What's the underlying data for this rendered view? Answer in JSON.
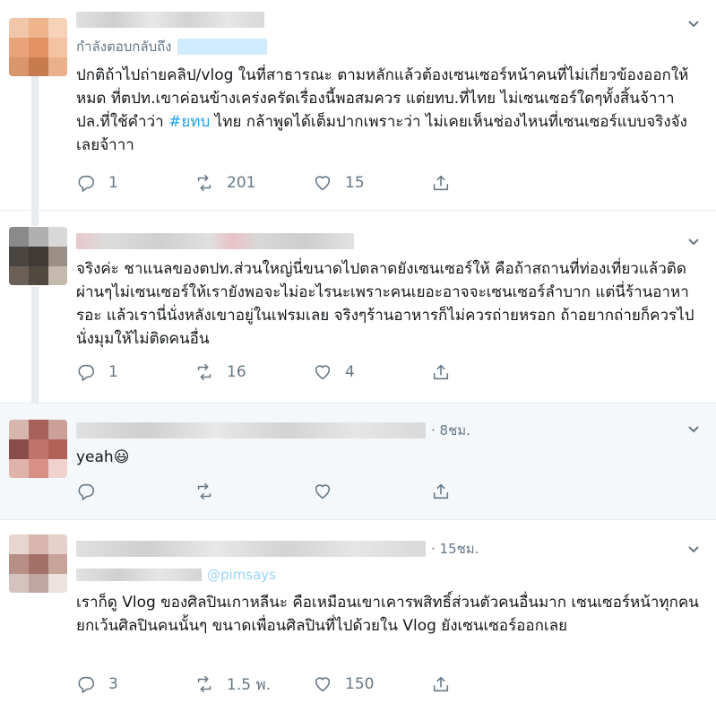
{
  "tweets": [
    {
      "timestamp": "",
      "reply_prefix": "กำลังตอบกลับถึง",
      "reply_handle": "",
      "text_before": "ปกติถ้าไปถ่ายคลิป/vlog ในที่สาธารณะ ตามหลักแล้วต้องเซนเซอร์หน้าคนที่ไม่เกี่ยวข้องออกให้หมด ที่ตปท.เขาค่อนข้างเคร่งครัดเรื่องนี้พอสมควร แต่ยทบ.ที่ไทย ไม่เซนเซอร์ใดๆทั้งสิ้นจ้าาา ปล.ที่ใช้คำว่า ",
      "hashtag": "#ยทบ",
      "text_after": " ไทย กล้าพูดได้เต็มปากเพราะว่า ไม่เคยเห็นช่องไหนที่เซนเซอร์แบบจริงจังเลยจ้าาา",
      "replies": "1",
      "retweets": "201",
      "likes": "15"
    },
    {
      "timestamp": "",
      "text": "จริงค่ะ ชาแนลของตปท.ส่วนใหญ่นี่ขนาดไปตลาดยังเซนเซอร์ให้ คือถ้าสถานที่ท่องเที่ยวแล้วติดผ่านๆไม่เซนเซอร์ให้เรายังพอจะไม่อะไรนะเพราะคนเยอะอาจจะเซนเซอร์ลำบาก แต่นี่ร้านอาหารอะ แล้วเรานี่นั่งหลังเขาอยู่ในเฟรมเลย จริงๆร้านอาหารก็ไม่ควรถ่ายหรอก ถ้าอยากถ่ายก็ควรไปนั่งมุมให้ไม่ติดคนอื่น",
      "replies": "1",
      "retweets": "16",
      "likes": "4"
    },
    {
      "timestamp": "· 8ชม.",
      "text": "yeah😃",
      "replies": "",
      "retweets": "",
      "likes": ""
    },
    {
      "timestamp": "· 15ชม.",
      "reply_handle": "@pimsays",
      "text": "เราก็ดู Vlog ของศิลปินเกาหลีนะ คือเหมือนเขาเคารพสิทธิ์ส่วนตัวคนอื่นมาก เซนเซอร์หน้าทุกคนยกเว้นศิลปินคนนั้นๆ ขนาดเพื่อนศิลปินที่ไปด้วยใน Vlog ยังเซนเซอร์ออกเลย",
      "replies": "3",
      "retweets": "1.5 พ.",
      "likes": "150"
    }
  ],
  "icons": {
    "reply": "reply-icon",
    "retweet": "retweet-icon",
    "like": "heart-icon",
    "share": "share-icon",
    "caret": "chevron-down-icon"
  },
  "colors": {
    "link": "#1da1f2",
    "muted": "#657786",
    "text": "#14171a",
    "highlight_bg": "#f5f8fa"
  }
}
